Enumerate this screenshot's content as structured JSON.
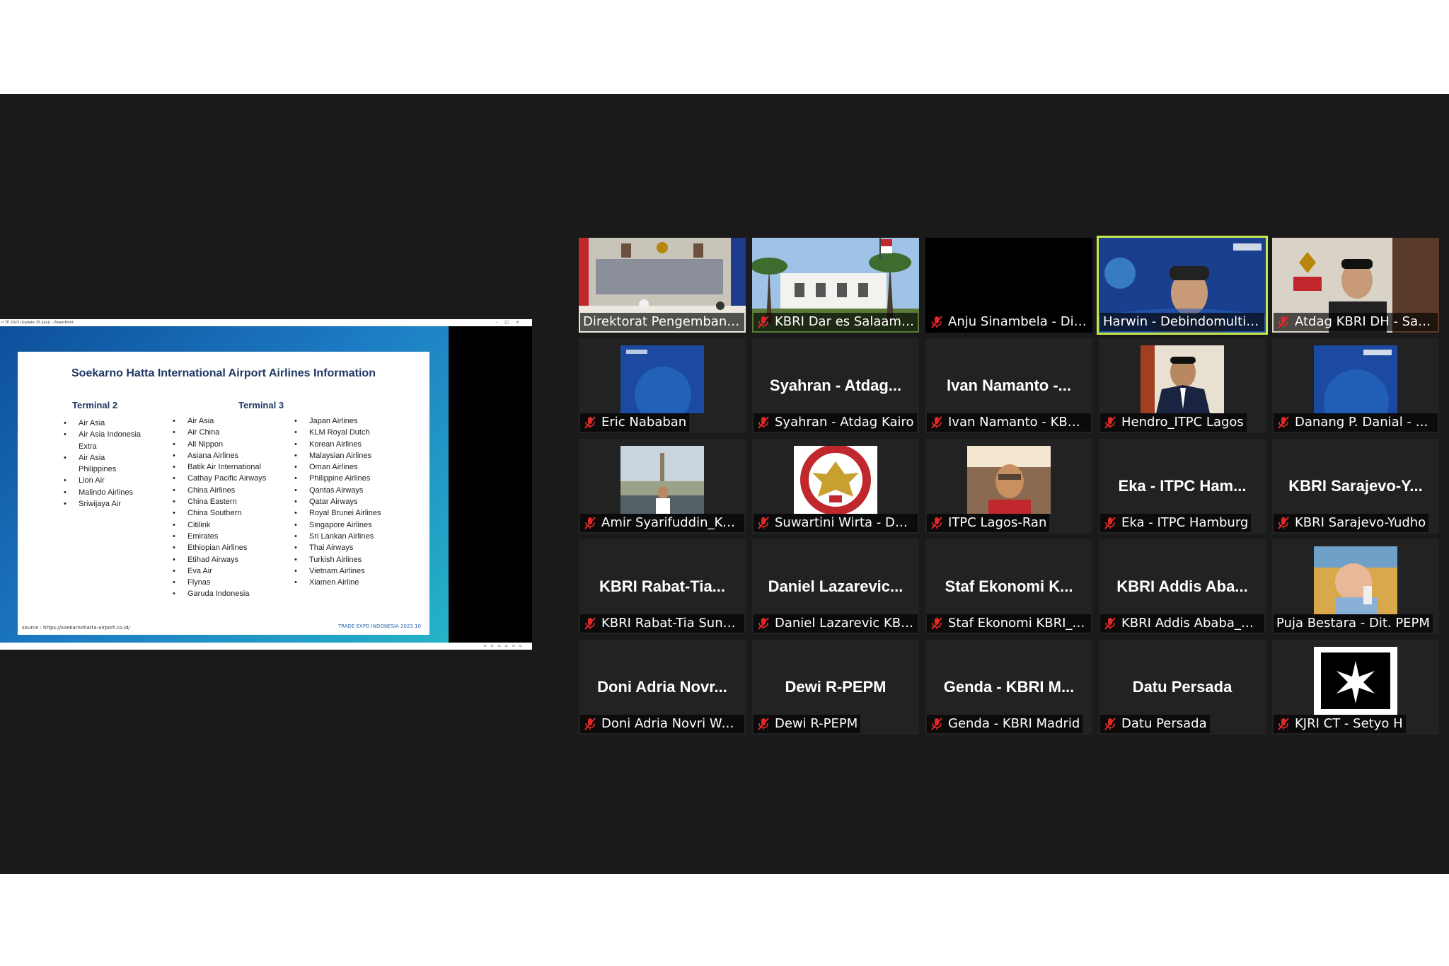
{
  "share": {
    "window_title": "n TE 2023 (Update 15 July)) - PowerPoint",
    "slide": {
      "title": "Soekarno Hatta International Airport Airlines Information",
      "terminal2_heading": "Terminal 2",
      "terminal3_heading": "Terminal 3",
      "terminal2": [
        "Air Asia",
        "Air Asia Indonesia Extra",
        "Air Asia Philippines",
        "Lion Air",
        "Malindo Airlines",
        "Sriwijaya Air"
      ],
      "terminal3_col1": [
        "Air Asia",
        "Air China",
        "All Nippon",
        "Asiana Airlines",
        "Batik Air International",
        "Cathay Pacific Airways",
        "China Airlines",
        "China Eastern",
        "China Southern",
        "Citilink",
        "Emirates",
        "Ethiopian Airlines",
        "Etihad Airways",
        "Eva Air",
        "Flynas",
        "Garuda Indonesia"
      ],
      "terminal3_col2": [
        "Japan Airlines",
        "KLM Royal Dutch",
        "Korean Airlines",
        "Malaysian Airlines",
        "Oman Airlines",
        "Philippine Airlines",
        "Qantas Airways",
        "Qatar Airways",
        "Royal Brunei Airlines",
        "Singapore Airlines",
        "Sri Lankan Airlines",
        "Thai Airways",
        "Turkish Airlines",
        "Vietnam Airlines",
        "Xiamen Airline"
      ],
      "source": "source : https://soekarnohatta-airport.co.id/",
      "footer": "TRADE EXPO INDONESIA 2023  10"
    }
  },
  "participants": [
    {
      "name": "Direktorat Pengembang...",
      "display": "",
      "muted": false,
      "video": "ministry"
    },
    {
      "name": "KBRI Dar es Salaam -...",
      "display": "",
      "muted": true,
      "video": "building"
    },
    {
      "name": "Anju Sinambela - Dit. ...",
      "display": "",
      "muted": true,
      "video": "black"
    },
    {
      "name": "Harwin - Debindomulti A...",
      "display": "",
      "muted": false,
      "video": "tradeexpo-person",
      "active": true
    },
    {
      "name": "Atdag KBRI DH - Sab...",
      "display": "",
      "muted": true,
      "video": "office-person"
    },
    {
      "name": "Eric Nababan",
      "display": "",
      "muted": true,
      "video": "blue-thumb"
    },
    {
      "name": "Syahran - Atdag Kairo",
      "display": "Syahran - Atdag...",
      "muted": true,
      "video": "none"
    },
    {
      "name": "Ivan Namanto - KBRI ...",
      "display": "Ivan Namanto -...",
      "muted": true,
      "video": "none"
    },
    {
      "name": "Hendro_ITPC Lagos",
      "display": "",
      "muted": true,
      "video": "suit-thumb"
    },
    {
      "name": "Danang P. Danial - At...",
      "display": "",
      "muted": true,
      "video": "tradeexpo-thumb"
    },
    {
      "name": "Amir Syarifuddin_Kairo",
      "display": "",
      "muted": true,
      "video": "cairo-thumb"
    },
    {
      "name": "Suwartini Wirta - Dub...",
      "display": "",
      "muted": true,
      "video": "emblem-thumb"
    },
    {
      "name": "ITPC Lagos-Ran",
      "display": "",
      "muted": true,
      "video": "selfie-thumb"
    },
    {
      "name": "Eka - ITPC Hamburg",
      "display": "Eka - ITPC Ham...",
      "muted": true,
      "video": "none"
    },
    {
      "name": "KBRI Sarajevo-Yudho",
      "display": "KBRI Sarajevo-Y...",
      "muted": true,
      "video": "none"
    },
    {
      "name": "KBRI Rabat-Tia Sundari",
      "display": "KBRI Rabat-Tia...",
      "muted": true,
      "video": "none"
    },
    {
      "name": "Daniel Lazarevic KBRI...",
      "display": "Daniel Lazarevic...",
      "muted": true,
      "video": "none"
    },
    {
      "name": "Staf Ekonomi KBRI_Al...",
      "display": "Staf Ekonomi K...",
      "muted": true,
      "video": "none"
    },
    {
      "name": "KBRI Addis Ababa_Ni...",
      "display": "KBRI Addis Aba...",
      "muted": true,
      "video": "none"
    },
    {
      "name": "Puja Bestara - Dit. PEPM",
      "display": "",
      "muted": false,
      "video": "baby-thumb"
    },
    {
      "name": "Doni Adria Novri Wak...",
      "display": "Doni Adria Novr...",
      "muted": true,
      "video": "none"
    },
    {
      "name": "Dewi R-PEPM",
      "display": "Dewi R-PEPM",
      "muted": true,
      "video": "none"
    },
    {
      "name": "Genda - KBRI Madrid",
      "display": "Genda - KBRI M...",
      "muted": true,
      "video": "none"
    },
    {
      "name": "Datu Persada",
      "display": "Datu Persada",
      "muted": true,
      "video": "none"
    },
    {
      "name": "KJRI CT - Setyo H",
      "display": "",
      "muted": true,
      "video": "logo-thumb"
    }
  ],
  "colors": {
    "meeting_bg": "#1a1a1a",
    "tile_bg": "#222222",
    "active_speaker": "#c6e84a",
    "mute_red": "#e02828"
  }
}
